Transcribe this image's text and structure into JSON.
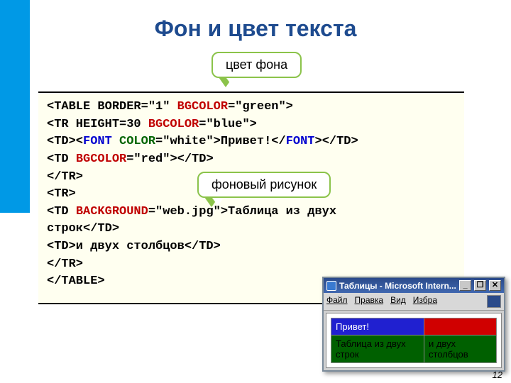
{
  "title": "Фон и цвет текста",
  "callouts": {
    "bgcolor": "цвет фона",
    "background": "фоновый рисунок"
  },
  "code": {
    "l1a": "<TABLE BORDER=\"1\" ",
    "l1b": "BGCOLOR",
    "l1c": "=\"green\">",
    "l2a": "<TR HEIGHT=30 ",
    "l2b": "BGCOLOR",
    "l2c": "=\"blue\">",
    "l3a": "   <TD><",
    "l3b": "FONT",
    "l3c": " ",
    "l3d": "COLOR",
    "l3e": "=\"white\">Привет!</",
    "l3f": "FONT",
    "l3g": "></TD>",
    "l4a": "   <TD ",
    "l4b": "BGCOLOR",
    "l4c": "=\"red\"></TD>",
    "l5": "</TR>",
    "l6": "<TR>",
    "l7a": "   <TD ",
    "l7b": "BACKGROUND",
    "l7c": "=\"web.jpg\">Таблица из двух",
    "l7d": "        строк</TD>",
    "l8": "   <TD>и двух столбцов</TD>",
    "l9": "</TR>",
    "l10": "</TABLE>"
  },
  "browser": {
    "title": "Таблицы - Microsoft Intern...",
    "menu": {
      "file": "Файл",
      "edit": "Правка",
      "view": "Вид",
      "fav": "Избра"
    },
    "btn_min": "_",
    "btn_max": "❐",
    "btn_close": "✕",
    "cells": {
      "c11": "Привет!",
      "c12": "",
      "c21": "Таблица из двух строк",
      "c22": "и двух столбцов"
    }
  },
  "page_number": "12"
}
